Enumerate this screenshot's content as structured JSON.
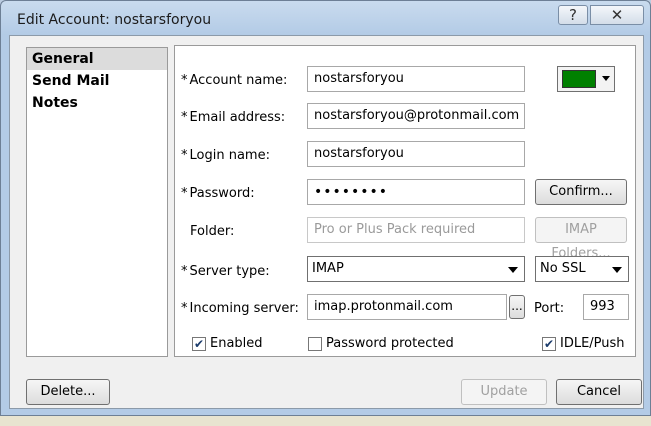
{
  "window": {
    "title": "Edit Account: nostarsforyou",
    "help_glyph": "?",
    "close_glyph": "✕"
  },
  "nav": {
    "items": [
      "General",
      "Send Mail",
      "Notes"
    ],
    "selected": "General"
  },
  "form": {
    "required_marker": "*",
    "account_name": {
      "label": "Account name:",
      "value": "nostarsforyou"
    },
    "account_color": "#008000",
    "email": {
      "label": "Email address:",
      "value": "nostarsforyou@protonmail.com"
    },
    "login": {
      "label": "Login name:",
      "value": "nostarsforyou"
    },
    "password": {
      "label": "Password:",
      "value": "••••••••",
      "confirm_label": "Confirm..."
    },
    "folder": {
      "label": "Folder:",
      "placeholder": "Pro or Plus Pack required",
      "imap_folders_label": "IMAP Folders..."
    },
    "server_type": {
      "label": "Server type:",
      "value": "IMAP",
      "security": "No SSL"
    },
    "incoming": {
      "label": "Incoming server:",
      "value": "imap.protonmail.com",
      "browse_label": "...",
      "port_label": "Port:",
      "port": "993"
    },
    "options": {
      "enabled": {
        "label": "Enabled",
        "checked": true
      },
      "password_protected": {
        "label": "Password protected",
        "checked": false
      },
      "idle_push": {
        "label": "IDLE/Push",
        "checked": true
      }
    }
  },
  "footer": {
    "delete_label": "Delete...",
    "update_label": "Update",
    "cancel_label": "Cancel"
  }
}
